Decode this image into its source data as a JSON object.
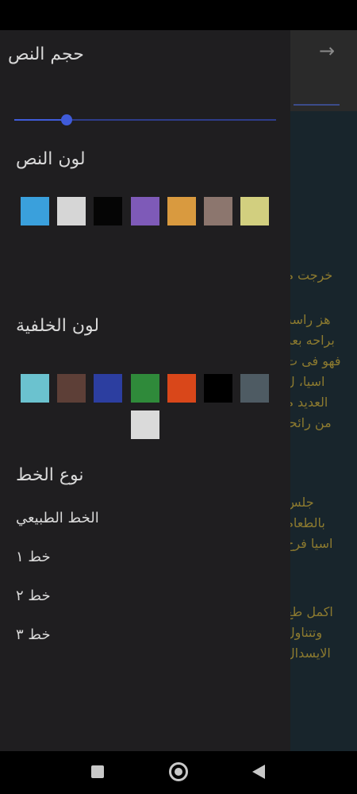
{
  "reader": {
    "back_icon": "arrow-right-icon",
    "paragraphs": [
      [
        "خرجت م"
      ],
      [
        "هز راسه",
        "براحه بعد",
        "فهو فى ت",
        "اسيا، ل",
        "العديد م",
        "من رائحا"
      ],
      [
        "جلس",
        "بالطعام",
        "اسيا فرح"
      ],
      [
        "اكمل طع",
        "وتتناول",
        "الايسدال"
      ]
    ]
  },
  "drawer": {
    "text_size": {
      "label": "حجم النص",
      "value_fraction": 0.2
    },
    "text_color": {
      "label": "لون النص",
      "swatches": [
        "#3aa0dc",
        "#d6d6d6",
        "#050505",
        "#7e5ab8",
        "#d99a3f",
        "#8c766e",
        "#d2cf7f"
      ]
    },
    "background_color": {
      "label": "لون الخلفية",
      "swatches": [
        "#6bc2cf",
        "#5d3f37",
        "#2c3ea0",
        "#2f8a3a",
        "#d9471a",
        "#000000",
        "#4e5b63",
        "#dadada"
      ]
    },
    "font_type": {
      "label": "نوع الخط",
      "options": [
        "الخط الطبيعي",
        "خط ١",
        "خط ٢",
        "خط ٣"
      ]
    }
  },
  "nav": {
    "recents_icon": "square-icon",
    "home_icon": "circle-icon",
    "back_icon": "triangle-back-icon"
  }
}
